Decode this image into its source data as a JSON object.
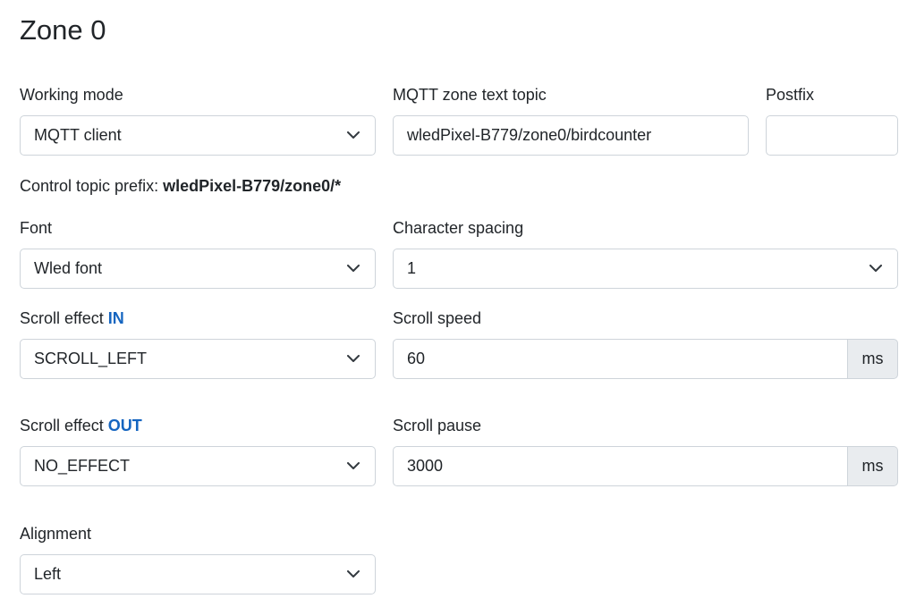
{
  "page": {
    "title": "Zone 0"
  },
  "working_mode": {
    "label": "Working mode",
    "value": "MQTT client"
  },
  "mqtt_topic": {
    "label": "MQTT zone text topic",
    "value": "wledPixel-B779/zone0/birdcounter"
  },
  "postfix": {
    "label": "Postfix",
    "value": ""
  },
  "control_prefix": {
    "label": "Control topic prefix:",
    "value": "wledPixel-B779/zone0/*"
  },
  "font": {
    "label": "Font",
    "value": "Wled font"
  },
  "char_spacing": {
    "label": "Character spacing",
    "value": "1"
  },
  "scroll_in": {
    "label": "Scroll effect",
    "accent": "IN",
    "value": "SCROLL_LEFT"
  },
  "scroll_speed": {
    "label": "Scroll speed",
    "value": "60",
    "unit": "ms"
  },
  "scroll_out": {
    "label": "Scroll effect",
    "accent": "OUT",
    "value": "NO_EFFECT"
  },
  "scroll_pause": {
    "label": "Scroll pause",
    "value": "3000",
    "unit": "ms"
  },
  "alignment": {
    "label": "Alignment",
    "value": "Left"
  },
  "colors": {
    "accent": "#1565c0",
    "border": "#ced4da",
    "addon_bg": "#e9ecef",
    "text": "#212529"
  },
  "icons": {
    "dropdown": "chevron-down-icon"
  }
}
